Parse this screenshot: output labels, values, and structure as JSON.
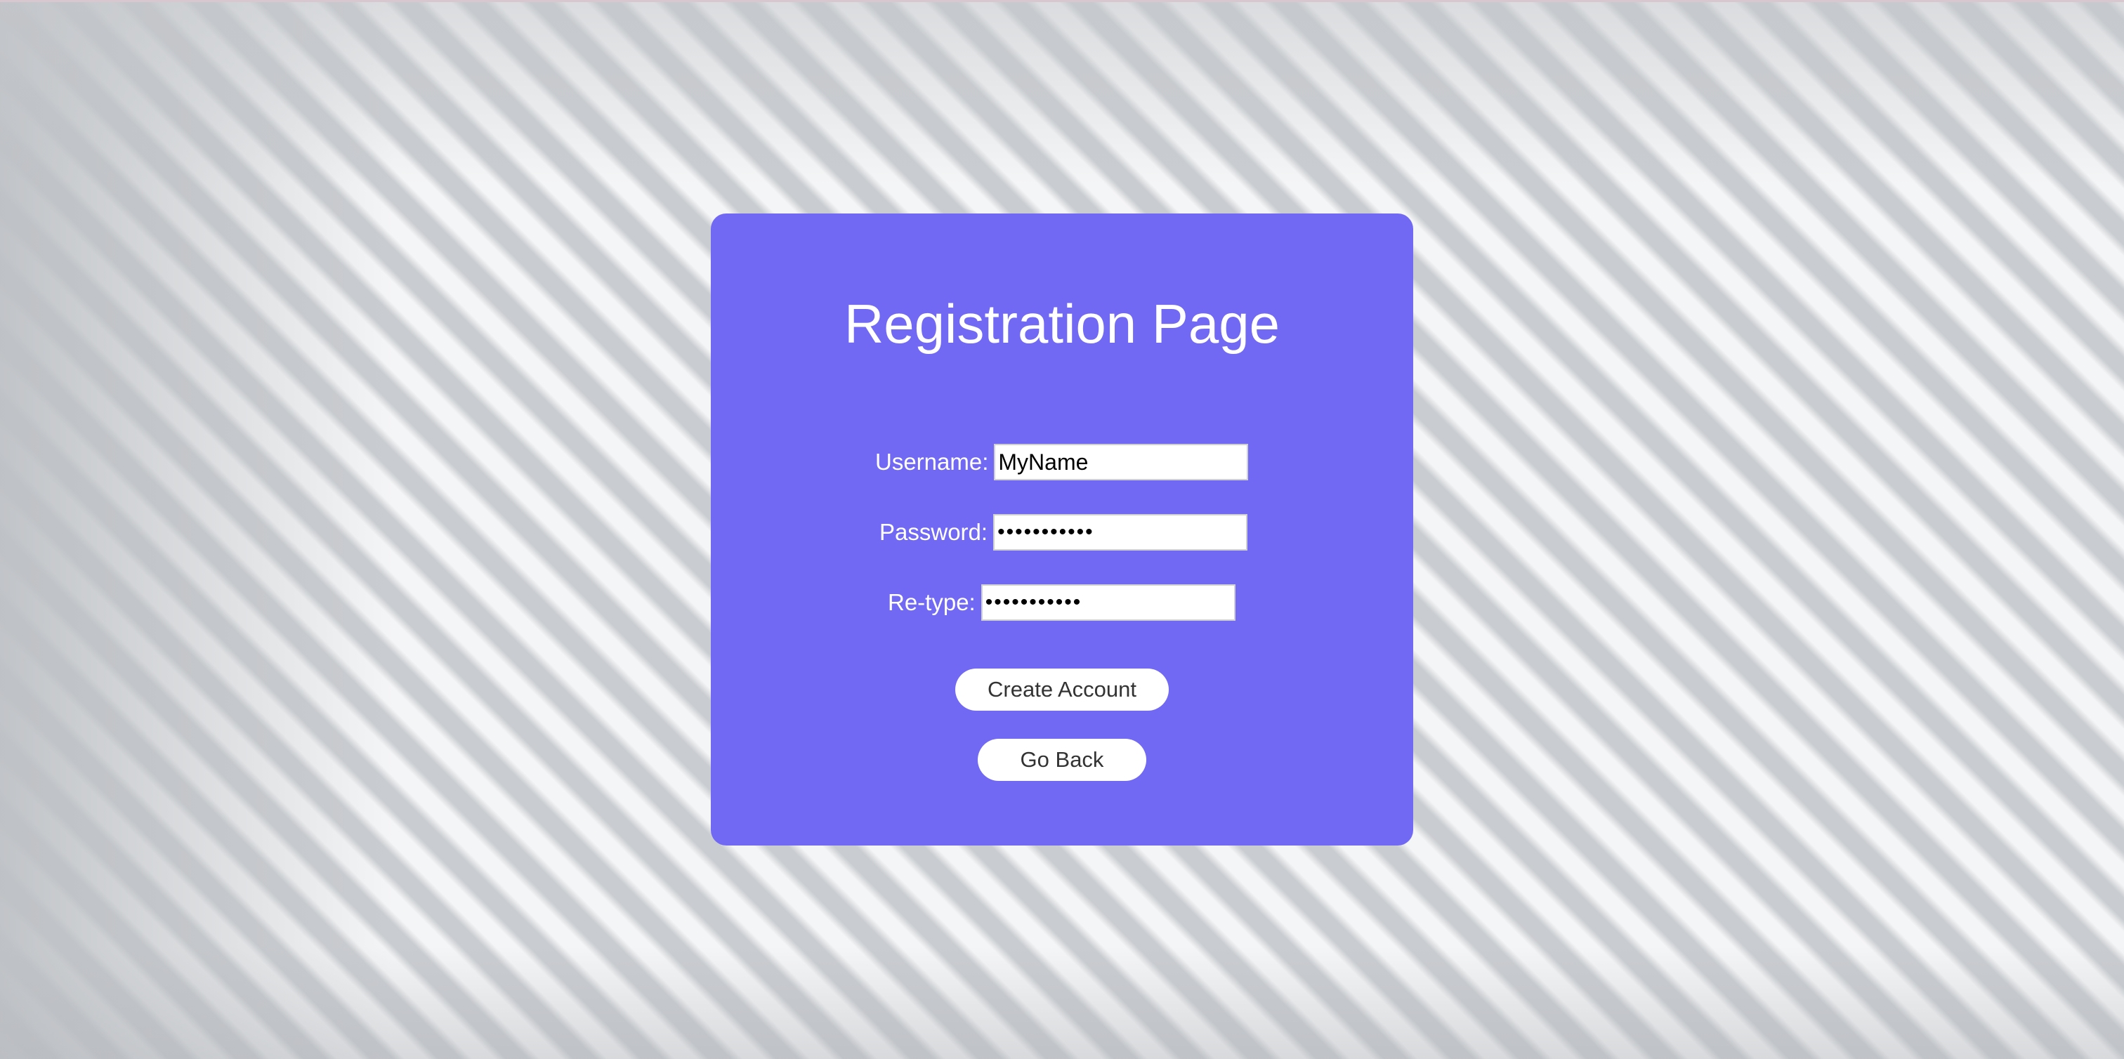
{
  "form": {
    "title": "Registration Page",
    "username_label": "Username:",
    "username_value": "MyName",
    "password_label": "Password:",
    "password_value": "•••••••••••",
    "retype_label": "Re-type:",
    "retype_value": "•••••••••••"
  },
  "buttons": {
    "create_label": "Create Account",
    "back_label": "Go Back"
  },
  "colors": {
    "card": "#7169f4",
    "button_bg": "#ffffff"
  }
}
